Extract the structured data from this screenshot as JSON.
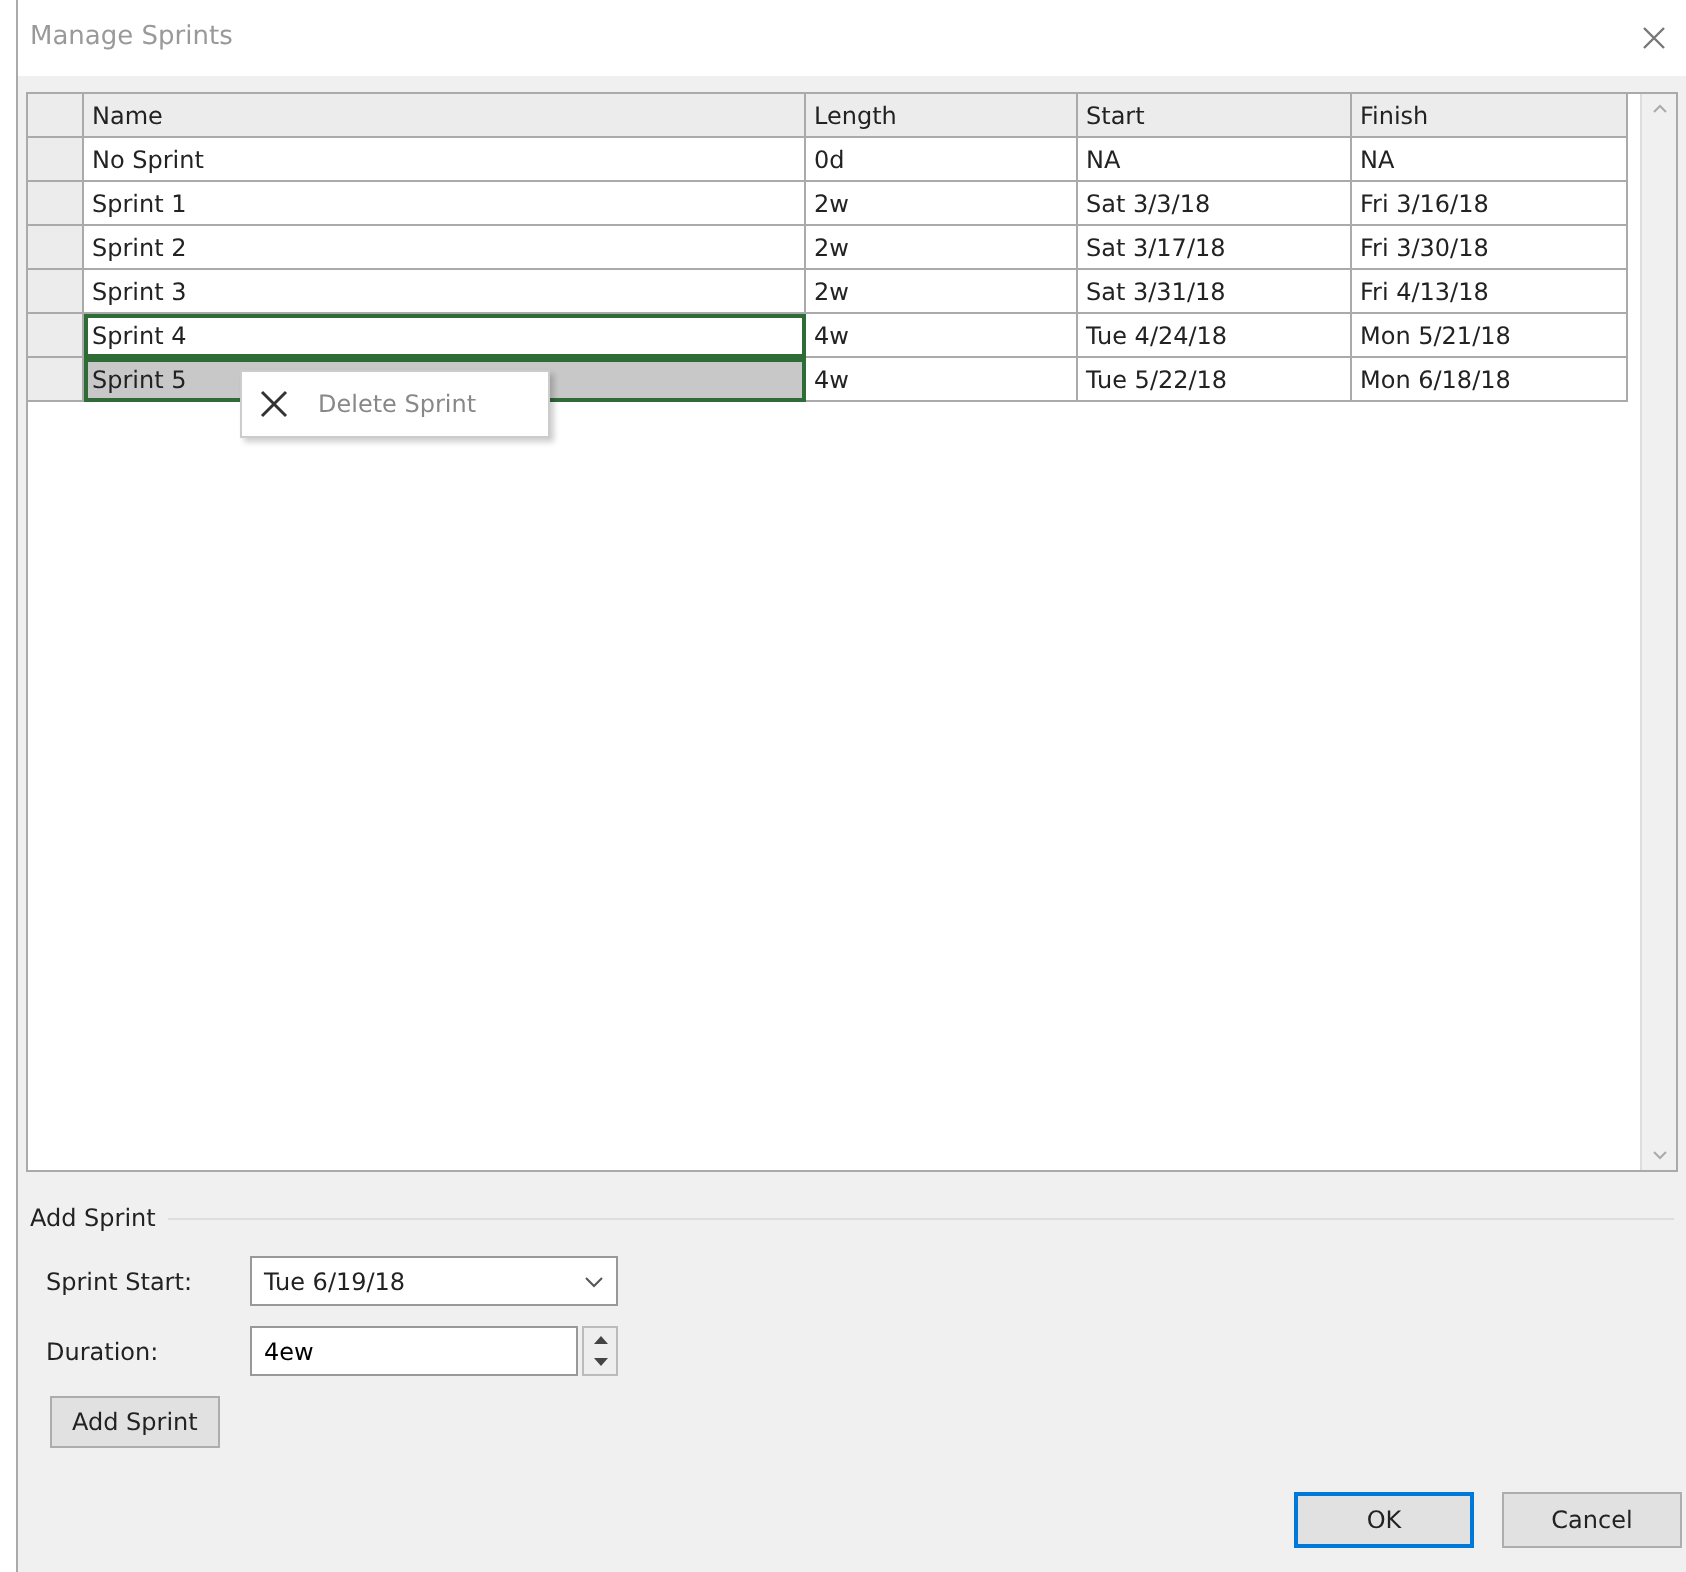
{
  "window": {
    "title": "Manage Sprints",
    "active": false
  },
  "table": {
    "columns": [
      "Name",
      "Length",
      "Start",
      "Finish"
    ],
    "rows": [
      {
        "cells": [
          "No Sprint",
          "0d",
          "NA",
          "NA"
        ],
        "selected": false,
        "highlighted": false
      },
      {
        "cells": [
          "Sprint 1",
          "2w",
          "Sat 3/3/18",
          "Fri 3/16/18"
        ],
        "selected": false,
        "highlighted": false
      },
      {
        "cells": [
          "Sprint 2",
          "2w",
          "Sat 3/17/18",
          "Fri 3/30/18"
        ],
        "selected": false,
        "highlighted": false
      },
      {
        "cells": [
          "Sprint 3",
          "2w",
          "Sat 3/31/18",
          "Fri 4/13/18"
        ],
        "selected": false,
        "highlighted": false
      },
      {
        "cells": [
          "Sprint 4",
          "4w",
          "Tue 4/24/18",
          "Mon 5/21/18"
        ],
        "selected": true,
        "highlighted": false
      },
      {
        "cells": [
          "Sprint 5",
          "4w",
          "Tue 5/22/18",
          "Mon 6/18/18"
        ],
        "selected": true,
        "highlighted": true
      }
    ]
  },
  "context_menu": {
    "items": [
      {
        "label": "Delete Sprint"
      }
    ]
  },
  "add_sprint": {
    "title": "Add Sprint",
    "sprint_start": {
      "label": "Sprint Start:",
      "value": "Tue 6/19/18"
    },
    "duration": {
      "label": "Duration:",
      "value": "4ew"
    },
    "button": "Add Sprint"
  },
  "buttons": [
    {
      "label": "OK",
      "default": true
    },
    {
      "label": "Cancel",
      "default": false
    }
  ]
}
